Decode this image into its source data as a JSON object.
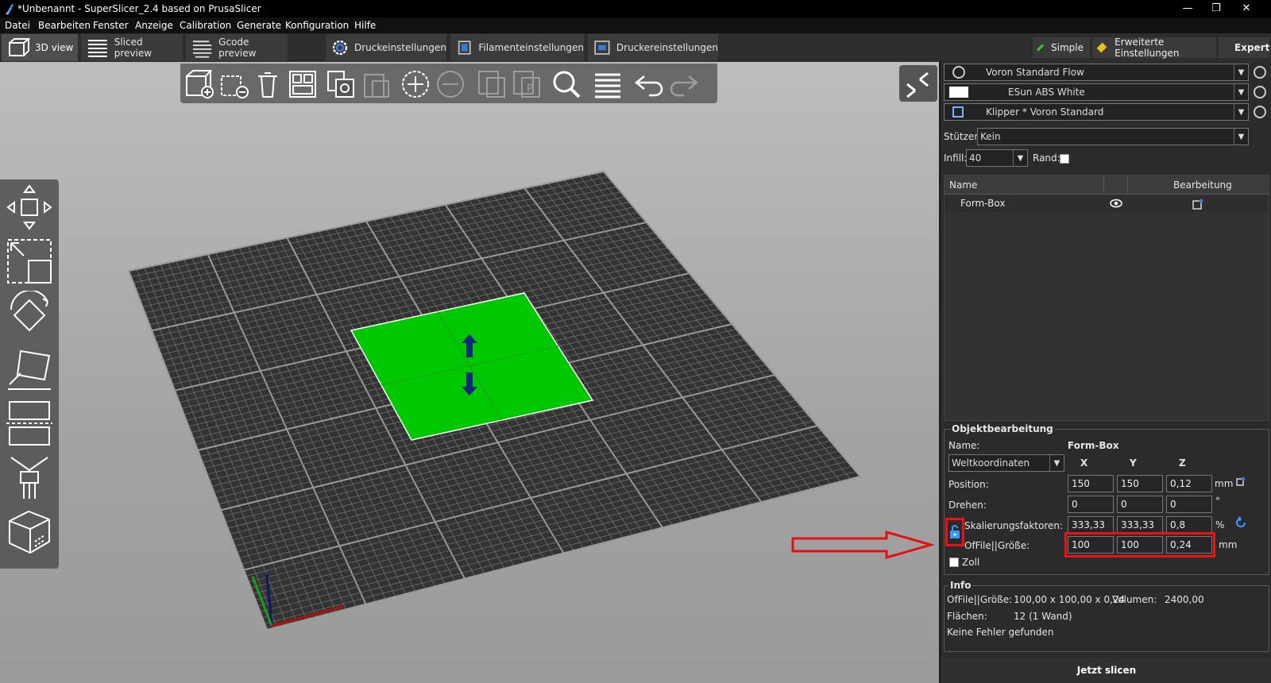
{
  "window": {
    "title": "*Unbenannt - SuperSlicer_2.4  based on PrusaSlicer",
    "controls": [
      "—",
      "❐",
      "✕"
    ]
  },
  "menu": [
    "Datei",
    "Bearbeiten",
    "Fenster",
    "Anzeige",
    "Calibration",
    "Generate",
    "Konfiguration",
    "Hilfe"
  ],
  "tabs": {
    "view3d": "3D view",
    "sliced": "Sliced preview",
    "gcode": "Gcode preview",
    "print": "Druckeinstellungen",
    "filament": "Filamenteinstellungen",
    "printer": "Druckereinstellungen"
  },
  "modes": {
    "simple": "Simple",
    "advanced": "Erweiterte Einstellungen",
    "expert": "Expert",
    "simple_color": "#3cc43c",
    "advanced_color": "#e6c21a",
    "expert_color": "#e02020"
  },
  "presets": {
    "print": "Voron Standard Flow",
    "filament": "ESun ABS White",
    "printer": "Klipper * Voron Standard",
    "supports_label": "Stützen:",
    "supports_value": "Kein",
    "infill_label": "Infill:",
    "infill_value": "40",
    "brim_label": "Rand:"
  },
  "objlist": {
    "col_name": "Name",
    "col_edit": "Bearbeitung",
    "rows": [
      {
        "name": "Form-Box"
      }
    ]
  },
  "objedit": {
    "title": "Objektbearbeitung",
    "name_label": "Name:",
    "name_value": "Form-Box",
    "coords": "Weltkoordinaten",
    "x": "X",
    "y": "Y",
    "z": "Z",
    "position_label": "Position:",
    "position": [
      "150",
      "150",
      "0,12"
    ],
    "position_unit": "mm",
    "rotate_label": "Drehen:",
    "rotate": [
      "0",
      "0",
      "0"
    ],
    "rotate_unit": "°",
    "scale_label": "Skalierungsfaktoren:",
    "scale": [
      "333,33",
      "333,33",
      "0,8"
    ],
    "scale_unit": "%",
    "size_label": "OfFile||Größe:",
    "size": [
      "100",
      "100",
      "0,24"
    ],
    "size_unit": "mm",
    "inch_label": "Zoll"
  },
  "info": {
    "title": "Info",
    "size_label": "OfFile||Größe:",
    "size_value": "100,00 x 100,00 x 0,24",
    "volume_label": "Volumen:",
    "volume_value": "2400,00",
    "facets_label": "Flächen:",
    "facets_value": "12 (1 Wand)",
    "errors": "Keine Fehler gefunden"
  },
  "slice_button": "Jetzt slicen",
  "colors": {
    "object_green": "#00c800",
    "highlight_red": "#e11111",
    "bed_dark": "#3a3a3a"
  }
}
